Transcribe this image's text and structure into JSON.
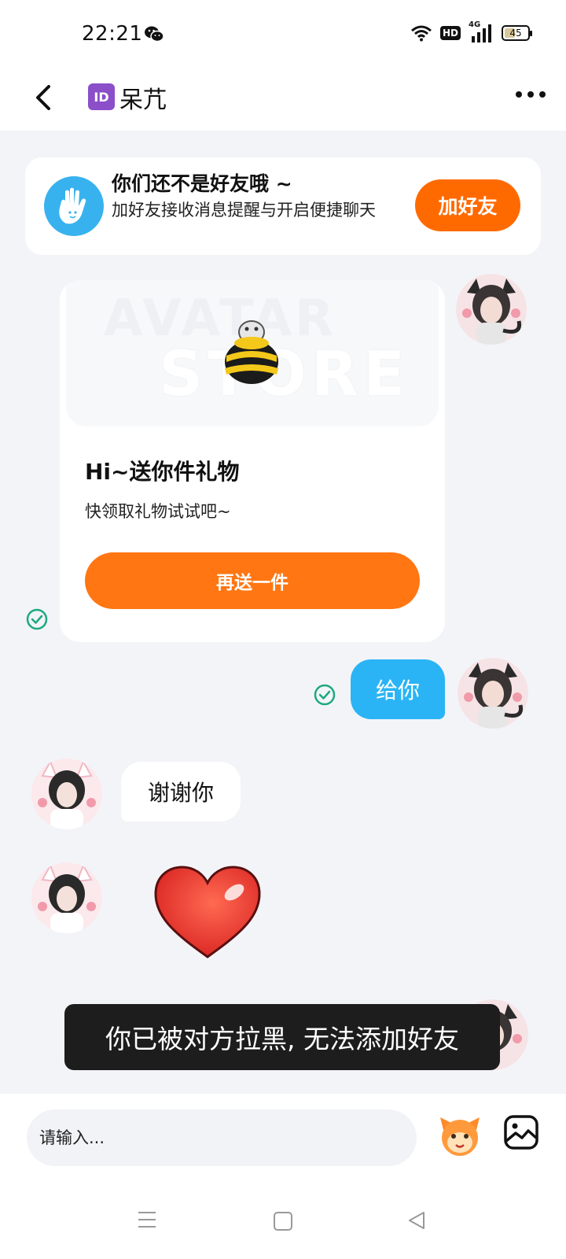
{
  "status_bar": {
    "time": "22:21",
    "network": "4G",
    "hd_label": "HD",
    "battery_level": "45",
    "icons": [
      "wechat-icon",
      "wifi-icon",
      "hd-icon",
      "signal-icon",
      "battery-icon"
    ]
  },
  "header": {
    "id_badge": "ID",
    "title": "呆芁",
    "back_icon": "chevron-left-icon",
    "more_icon": "more-icon"
  },
  "friend_banner": {
    "title": "你们还不是好友哦 ~",
    "description": "加好友接收消息提醒与开启便捷聊天",
    "button_label": "加好友",
    "icon": "wave-hand-icon",
    "accent_color": "#ff6a00"
  },
  "gift_card": {
    "watermark_line1": "AVATAR",
    "watermark_line2": "STORE",
    "title": "Hi~送你件礼物",
    "subtitle": "快领取礼物试试吧~",
    "button_label": "再送一件",
    "image": "bee-gift-icon",
    "button_color": "#ff7612"
  },
  "messages": [
    {
      "direction": "sent",
      "text": "给你",
      "status": "read"
    },
    {
      "direction": "received",
      "text": "谢谢你"
    },
    {
      "direction": "received",
      "sticker": "heart-sticker"
    }
  ],
  "toast": {
    "text": "你已被对方拉黑, 无法添加好友"
  },
  "input_bar": {
    "placeholder": "请输入...",
    "emoji_icon": "emoji-icon",
    "image_icon": "image-icon"
  },
  "nav_bar": {
    "icons": [
      "menu-icon",
      "home-icon",
      "back-icon"
    ]
  },
  "colors": {
    "sent_bubble": "#2ab4f5",
    "read_check": "#1fa97a",
    "background": "#f3f4f8"
  }
}
